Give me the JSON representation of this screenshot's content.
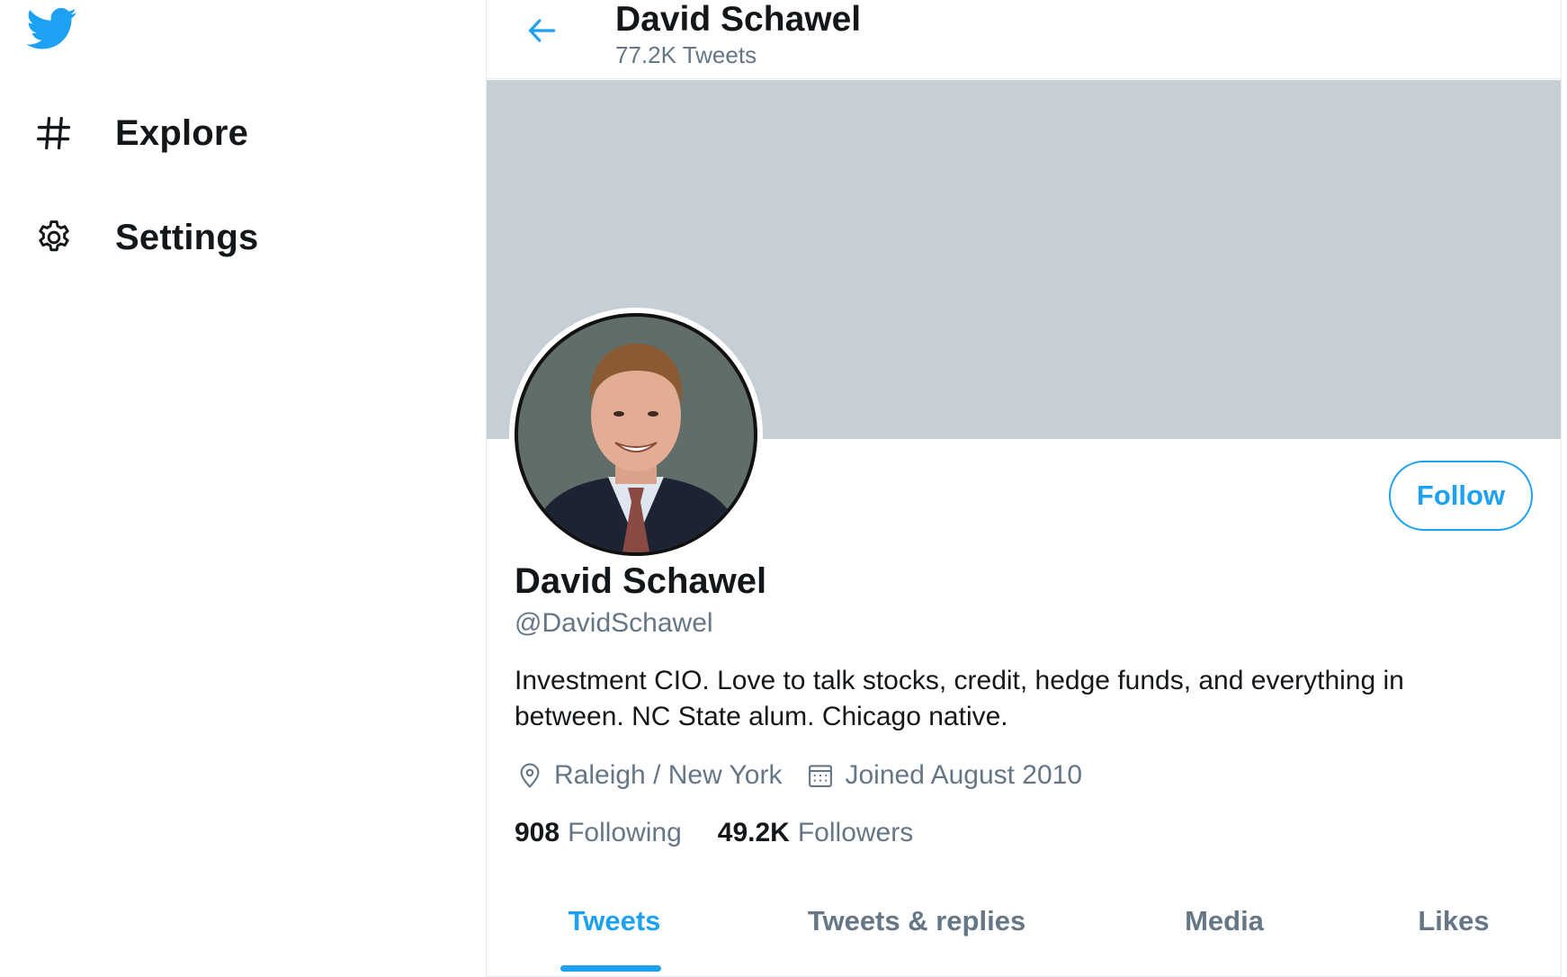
{
  "sidebar": {
    "logo_icon": "twitter-bird-icon",
    "items": [
      {
        "label": "Explore",
        "icon": "hashtag-icon"
      },
      {
        "label": "Settings",
        "icon": "gear-icon"
      }
    ]
  },
  "header": {
    "back_icon": "back-arrow-icon",
    "name": "David Schawel",
    "tweet_count": "77.2K Tweets"
  },
  "profile": {
    "name": "David Schawel",
    "handle": "@DavidSchawel",
    "follow_label": "Follow",
    "bio": "Investment CIO. Love to talk stocks, credit, hedge funds, and everything in between. NC State alum. Chicago native.",
    "location": "Raleigh / New York",
    "joined": "Joined August 2010",
    "following_count": "908",
    "following_label": "Following",
    "followers_count": "49.2K",
    "followers_label": "Followers"
  },
  "tabs": [
    {
      "label": "Tweets",
      "active": true
    },
    {
      "label": "Tweets & replies",
      "active": false
    },
    {
      "label": "Media",
      "active": false
    },
    {
      "label": "Likes",
      "active": false
    }
  ],
  "colors": {
    "accent": "#1da1f2",
    "secondary_text": "#657786",
    "banner": "#c6ced6"
  }
}
